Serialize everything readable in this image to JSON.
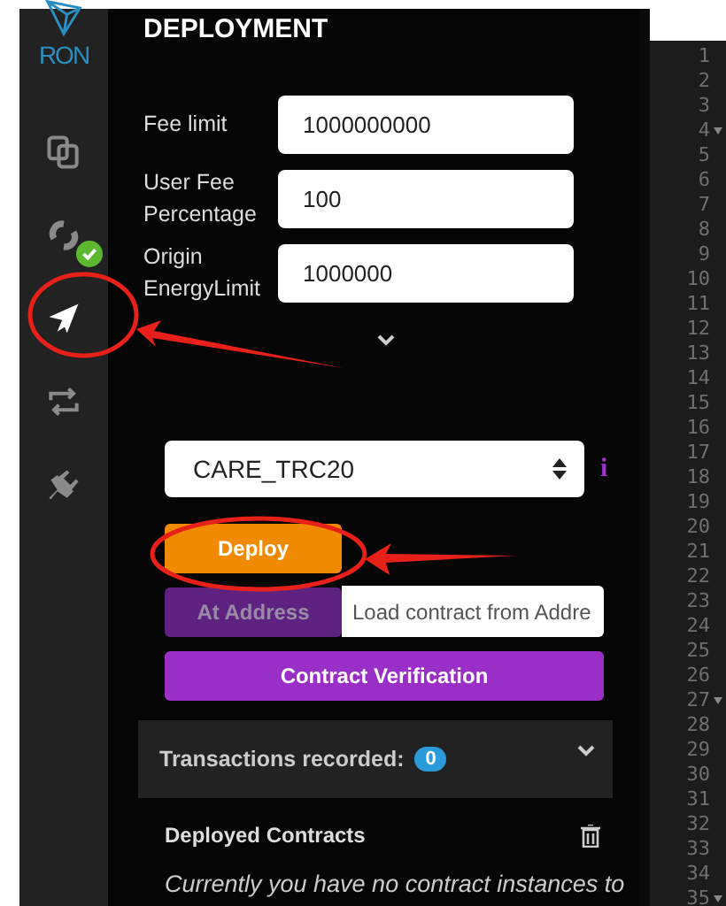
{
  "sidebar": {
    "logo": "RON",
    "items": [
      {
        "kind": "copy",
        "selected": false
      },
      {
        "kind": "sync",
        "selected": false,
        "badge": true
      },
      {
        "kind": "send",
        "selected": true
      },
      {
        "kind": "repeat",
        "selected": false
      },
      {
        "kind": "plug",
        "selected": false
      }
    ]
  },
  "panel": {
    "title": "DEPLOYMENT",
    "fields": [
      {
        "label": "Fee limit",
        "value": "1000000000"
      },
      {
        "label": "User Fee Percentage",
        "value": "100"
      },
      {
        "label": "Origin EnergyLimit",
        "value": "1000000"
      }
    ],
    "contract_select": {
      "value": "CARE_TRC20"
    },
    "info_label": "i",
    "deploy_button": "Deploy",
    "at_address_button": "At Address",
    "address_field": {
      "placeholder": "Load contract from Addre"
    },
    "verify_button": "Contract Verification",
    "transactions": {
      "label": "Transactions recorded:",
      "count": "0",
      "expanded": false
    },
    "deployed": {
      "title": "Deployed Contracts",
      "message": "Currently you have no contract instances to"
    }
  },
  "editor": {
    "lines": [
      {
        "number": "1",
        "foldable": false
      },
      {
        "number": "2",
        "foldable": false
      },
      {
        "number": "3",
        "foldable": false
      },
      {
        "number": "4",
        "foldable": true
      },
      {
        "number": "5",
        "foldable": false
      },
      {
        "number": "6",
        "foldable": false
      },
      {
        "number": "7",
        "foldable": false
      },
      {
        "number": "8",
        "foldable": false
      },
      {
        "number": "9",
        "foldable": false
      },
      {
        "number": "10",
        "foldable": false
      },
      {
        "number": "11",
        "foldable": false
      },
      {
        "number": "12",
        "foldable": false
      },
      {
        "number": "13",
        "foldable": false
      },
      {
        "number": "14",
        "foldable": false
      },
      {
        "number": "15",
        "foldable": false
      },
      {
        "number": "16",
        "foldable": false
      },
      {
        "number": "17",
        "foldable": false
      },
      {
        "number": "18",
        "foldable": false
      },
      {
        "number": "19",
        "foldable": false
      },
      {
        "number": "20",
        "foldable": false
      },
      {
        "number": "21",
        "foldable": false
      },
      {
        "number": "22",
        "foldable": false
      },
      {
        "number": "23",
        "foldable": false
      },
      {
        "number": "24",
        "foldable": false
      },
      {
        "number": "25",
        "foldable": false
      },
      {
        "number": "26",
        "foldable": false
      },
      {
        "number": "27",
        "foldable": true
      },
      {
        "number": "28",
        "foldable": false
      },
      {
        "number": "29",
        "foldable": false
      },
      {
        "number": "30",
        "foldable": false
      },
      {
        "number": "31",
        "foldable": false
      },
      {
        "number": "32",
        "foldable": false
      },
      {
        "number": "33",
        "foldable": false
      },
      {
        "number": "34",
        "foldable": false
      },
      {
        "number": "35",
        "foldable": true
      }
    ]
  }
}
